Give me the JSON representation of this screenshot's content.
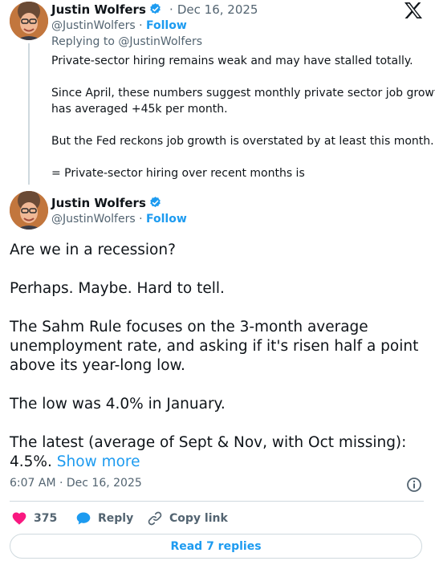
{
  "reply_tweet": {
    "author_name": "Justin Wolfers",
    "date": "Dec 16, 2025",
    "date_separator": "·",
    "handle": "@JustinWolfers",
    "replying_to": "Replying to @JustinWolfers",
    "lines": [
      "Private-sector hiring remains weak and may have stalled totally.",
      "Since April, these numbers suggest monthly private sector job growth",
      "has averaged +45k per month.",
      "But the Fed reckons job growth is overstated by at least this month.",
      "= Private-sector hiring over recent months is"
    ]
  },
  "main_tweet": {
    "author_name": "Justin Wolfers",
    "handle": "@JustinWolfers",
    "handle_separator": "·",
    "follow_label": "Follow",
    "lines": [
      "Are we in a recession?",
      "Perhaps. Maybe. Hard to tell.",
      "The Sahm Rule focuses on the  3-month average",
      "unemployment rate, and asking if it's risen half a point",
      "above its year-long low.",
      "The low was 4.0% in January.",
      "The latest (average of Sept & Nov, with Oct missing):",
      "4.5%."
    ],
    "show_more": "Show more",
    "timestamp": "6:07 AM · Dec 16, 2025"
  },
  "actions": {
    "likes_count": "375",
    "reply_label": "Reply",
    "copy_link_label": "Copy link",
    "read_replies_label": "Read 7 replies"
  },
  "icons": {
    "logo": "x-logo-icon",
    "verified": "verified-badge-icon",
    "info": "info-icon",
    "like": "heart-icon",
    "reply": "speech-bubble-icon",
    "copy_link": "link-icon"
  },
  "colors": {
    "accent": "#1d9bf0",
    "like": "#f91880",
    "text": "#0f1419",
    "muted": "#536471",
    "border": "#cfd9de"
  }
}
